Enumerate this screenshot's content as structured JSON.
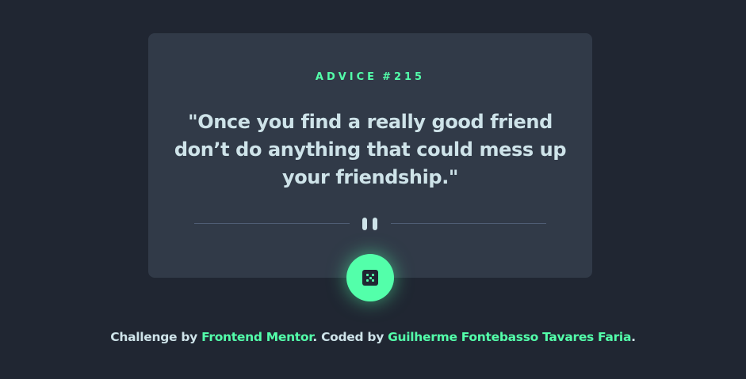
{
  "card": {
    "advice_label": "ADVICE",
    "advice_number": "#215",
    "quote": "\"Once you find a really good friend don’t do anything that could mess up your friendship.\""
  },
  "dice_button": {
    "icon": "dice-icon"
  },
  "footer": {
    "challenge_text": "Challenge by",
    "challenge_link": "Frontend Mentor",
    "coded_text": ". Coded by",
    "author_link": "Guilherme Fontebasso Tavares Faria",
    "end_text": "."
  },
  "colors": {
    "background": "#202632",
    "card": "#313a48",
    "accent": "#53ffaa",
    "text": "#cee3e9",
    "divider": "#4f5d74"
  }
}
